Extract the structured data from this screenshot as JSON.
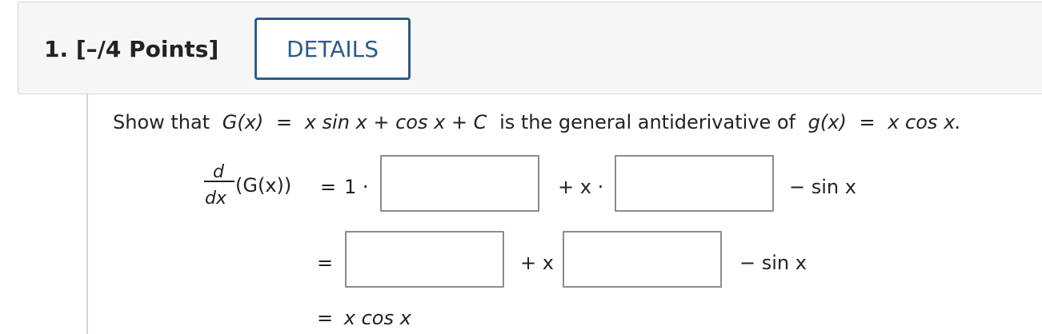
{
  "question": {
    "number_label": "1.",
    "points_label": "[–/4 Points]",
    "details_label": "DETAILS"
  },
  "prompt": {
    "show_that": "Show that",
    "G_of_x": "G(x)",
    "eq": "=",
    "G_expression": "x sin x + cos x + C",
    "is_the": "is the general antiderivative of",
    "g_of_x": "g(x)",
    "g_expression": "x cos x."
  },
  "derivation": {
    "d": "d",
    "dx": "dx",
    "G_call": "(G(x))",
    "line1": {
      "eq": "=",
      "one_times": "1 ·",
      "plus_x_times": "+ x ·",
      "minus_sin": "− sin x",
      "blank1_value": "",
      "blank2_value": ""
    },
    "line2": {
      "eq": "=",
      "plus_x": "+ x",
      "minus_sin": "− sin x",
      "blank1_value": "",
      "blank2_value": ""
    },
    "line3": {
      "eq": "=",
      "result": "x cos x"
    }
  }
}
